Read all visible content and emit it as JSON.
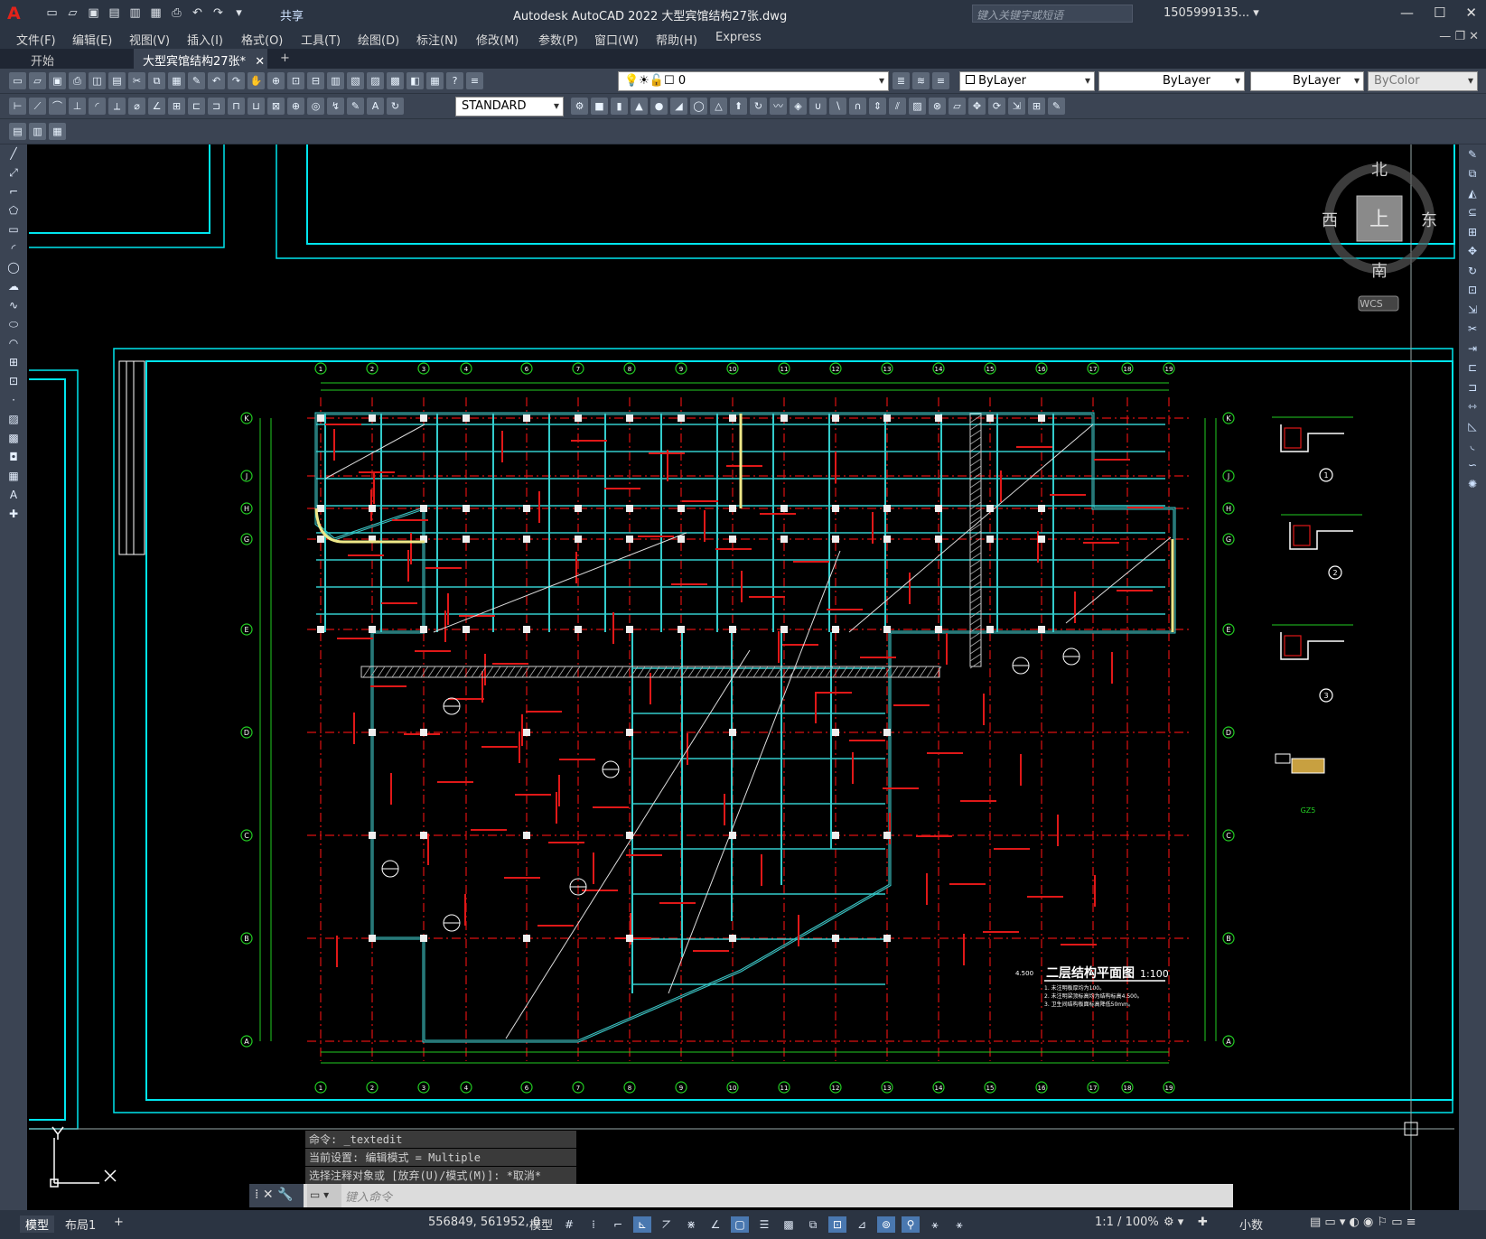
{
  "app": {
    "title": "Autodesk AutoCAD 2022    大型宾馆结构27张.dwg",
    "logo": "A",
    "share": "共享",
    "search_placeholder": "键入关键字或短语",
    "user": "1505999135... ▾",
    "window_controls": [
      "—",
      "☐",
      "✕"
    ]
  },
  "menu": [
    "文件(F)",
    "编辑(E)",
    "视图(V)",
    "插入(I)",
    "格式(O)",
    "工具(T)",
    "绘图(D)",
    "标注(N)",
    "修改(M)",
    "参数(P)",
    "窗口(W)",
    "帮助(H)",
    "Express"
  ],
  "tabs": {
    "start": "开始",
    "active": "大型宾馆结构27张*",
    "add": "+"
  },
  "toolbar": {
    "layer": "0",
    "color": "ByLayer",
    "linetype": "ByLayer",
    "lineweight": "ByLayer",
    "plotstyle": "ByColor",
    "textstyle": "STANDARD"
  },
  "viewcube": {
    "north": "北",
    "south": "南",
    "east": "东",
    "west": "西",
    "top": "上",
    "wcs": "WCS"
  },
  "drawing": {
    "title": "二层结构平面图",
    "scale": "1:100",
    "level": "4.500",
    "notes": [
      "1. 未注明板厚均为100。",
      "2. 未注明梁顶标高均为结构标高4.500。",
      "3. 卫生间结构板面标高降低50mm。"
    ],
    "col_axes": [
      "1",
      "2",
      "3",
      "4",
      "6",
      "7",
      "8",
      "9",
      "10",
      "11",
      "12",
      "13",
      "14",
      "15",
      "16",
      "17",
      "18",
      "19"
    ],
    "row_axes": [
      "K",
      "J",
      "H",
      "G",
      "E",
      "D",
      "C",
      "B",
      "A"
    ],
    "details": [
      "1",
      "2",
      "3"
    ],
    "gz_label": "GZ5"
  },
  "command_history": [
    "命令: _textedit",
    "当前设置: 编辑模式 = Multiple",
    "选择注释对象或 [放弃(U)/模式(M)]: *取消*"
  ],
  "command_prompt": "键入命令",
  "status": {
    "model_tab": "模型",
    "layout_tab": "布局1",
    "add": "+",
    "coords": "556849, 561952, 0",
    "space": "模型",
    "scale": "1:1 / 100%",
    "units": "小数"
  }
}
